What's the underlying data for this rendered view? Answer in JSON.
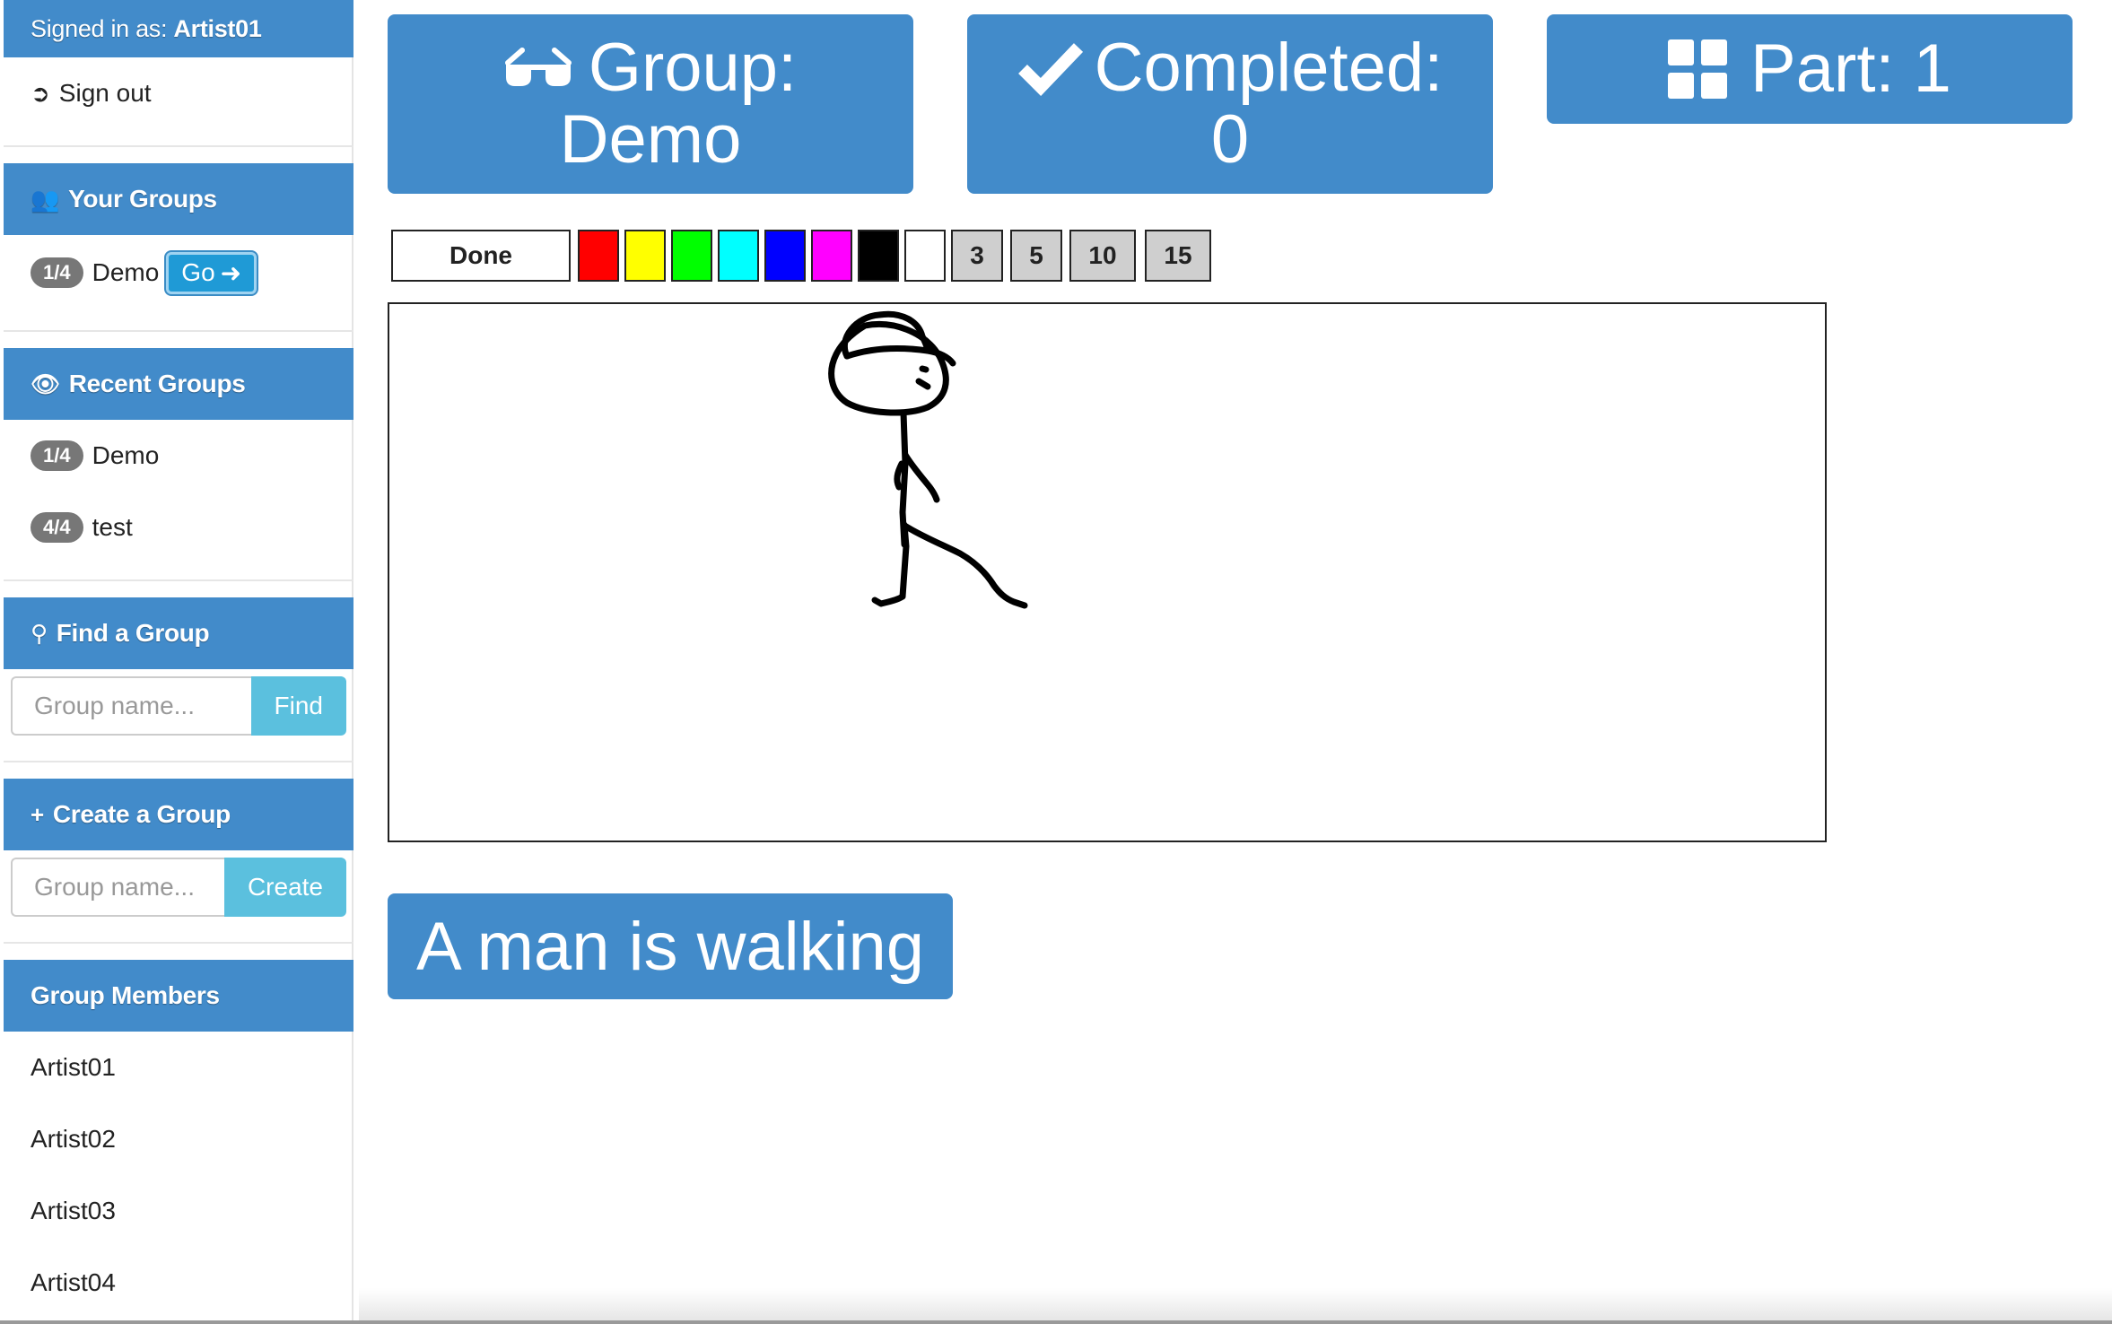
{
  "sidebar": {
    "signed_in": {
      "prefix": "Signed in as: ",
      "user": "Artist01"
    },
    "sign_out": "Sign out",
    "your_groups": {
      "title": "Your Groups",
      "items": [
        {
          "badge": "1/4",
          "name": "Demo",
          "go": "Go"
        }
      ]
    },
    "recent_groups": {
      "title": "Recent Groups",
      "items": [
        {
          "badge": "1/4",
          "name": "Demo"
        },
        {
          "badge": "4/4",
          "name": "test"
        }
      ]
    },
    "find_group": {
      "title": "Find a Group",
      "placeholder": "Group name...",
      "button": "Find"
    },
    "create_group": {
      "title": "Create a Group",
      "placeholder": "Group name...",
      "button": "Create"
    },
    "members": {
      "title": "Group Members",
      "items": [
        "Artist01",
        "Artist02",
        "Artist03",
        "Artist04"
      ]
    }
  },
  "header": {
    "group": {
      "label": "Group:",
      "value": "Demo"
    },
    "completed": {
      "label": "Completed:",
      "value": "0"
    },
    "part": {
      "label": "Part: 1"
    }
  },
  "toolbar": {
    "done": "Done",
    "colors": [
      "#ff0000",
      "#ffff00",
      "#00ff00",
      "#00ffff",
      "#0000ff",
      "#ff00ff",
      "#000000",
      "#ffffff"
    ],
    "sizes": [
      "3",
      "5",
      "10",
      "15"
    ]
  },
  "prompt": "A man is walking",
  "colors": {
    "primary": "#428bca",
    "info": "#5bc0de",
    "badge": "#777777"
  }
}
